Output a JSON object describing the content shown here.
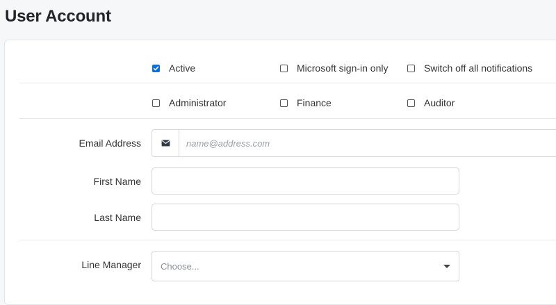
{
  "page": {
    "title": "User Account"
  },
  "checkboxes": {
    "row1": [
      {
        "label": "Active",
        "checked": true
      },
      {
        "label": "Microsoft sign-in only",
        "checked": false
      },
      {
        "label": "Switch off all notifications",
        "checked": false
      }
    ],
    "row2": [
      {
        "label": "Administrator",
        "checked": false
      },
      {
        "label": "Finance",
        "checked": false
      },
      {
        "label": "Auditor",
        "checked": false
      }
    ]
  },
  "fields": {
    "email": {
      "label": "Email Address",
      "placeholder": "name@address.com",
      "value": "",
      "icon": "envelope-icon"
    },
    "first_name": {
      "label": "First Name",
      "value": ""
    },
    "last_name": {
      "label": "Last Name",
      "value": ""
    },
    "line_manager": {
      "label": "Line Manager",
      "placeholder": "Choose..."
    }
  },
  "colors": {
    "accent": "#0b6fe0",
    "border": "#d4d8dd",
    "background": "#f6f7f9"
  }
}
